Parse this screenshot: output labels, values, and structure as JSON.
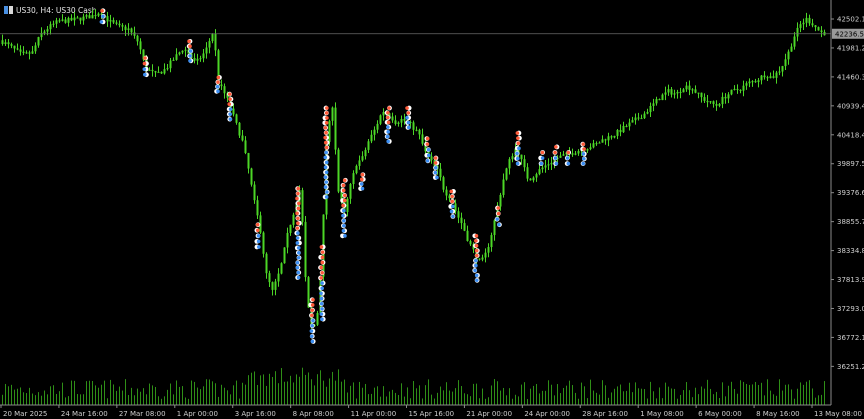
{
  "window": {
    "title": "US30, H4: US30 Cash"
  },
  "colors": {
    "background": "#000000",
    "candle": "#4cd626",
    "volume": "#2f8f17",
    "axis": "#8a8a8a",
    "label": "#cfcfcf",
    "price_line": "#6a6a6a",
    "price_box": "#9a9a9a",
    "marker_sell": "#ff5b3a",
    "marker_buy": "#3c8ef2"
  },
  "chart_data": {
    "type": "candlestick",
    "symbol": "US30",
    "timeframe": "H4",
    "current_price": "42236.51",
    "y_ticks": [
      "42502.13",
      "41981.22",
      "41460.31",
      "40939.40",
      "40418.49",
      "39897.58",
      "39376.67",
      "38855.76",
      "38334.85",
      "37813.94",
      "37293.03",
      "36772.12",
      "36251.21"
    ],
    "x_ticks": [
      "20 Mar 2025",
      "24 Mar 16:00",
      "27 Mar 08:00",
      "1 Apr 00:00",
      "3 Apr 16:00",
      "8 Apr 08:00",
      "11 Apr 00:00",
      "15 Apr 16:00",
      "21 Apr 00:00",
      "24 Apr 00:00",
      "28 Apr 16:00",
      "1 May 08:00",
      "6 May 00:00",
      "8 May 16:00",
      "13 May 08:00"
    ],
    "ylim": [
      36150,
      42700
    ],
    "close_path": [
      [
        0,
        42120
      ],
      [
        12,
        41980
      ],
      [
        22,
        41850
      ],
      [
        32,
        41900
      ],
      [
        40,
        42220
      ],
      [
        48,
        42350
      ],
      [
        58,
        42460
      ],
      [
        70,
        42480
      ],
      [
        82,
        42520
      ],
      [
        92,
        42560
      ],
      [
        100,
        42640
      ],
      [
        108,
        42470
      ],
      [
        118,
        42360
      ],
      [
        128,
        42320
      ],
      [
        138,
        42080
      ],
      [
        145,
        41620
      ],
      [
        155,
        41500
      ],
      [
        165,
        41600
      ],
      [
        175,
        41820
      ],
      [
        183,
        41980
      ],
      [
        188,
        41890
      ],
      [
        195,
        41700
      ],
      [
        205,
        41920
      ],
      [
        213,
        42300
      ],
      [
        218,
        41350
      ],
      [
        226,
        41100
      ],
      [
        234,
        40700
      ],
      [
        242,
        40300
      ],
      [
        248,
        39800
      ],
      [
        254,
        39200
      ],
      [
        260,
        38700
      ],
      [
        266,
        37900
      ],
      [
        272,
        37600
      ],
      [
        280,
        38000
      ],
      [
        288,
        38700
      ],
      [
        296,
        39200
      ],
      [
        300,
        39500
      ],
      [
        306,
        37500
      ],
      [
        312,
        36850
      ],
      [
        318,
        37300
      ],
      [
        322,
        38500
      ],
      [
        326,
        40300
      ],
      [
        332,
        40950
      ],
      [
        338,
        39400
      ],
      [
        344,
        39000
      ],
      [
        350,
        39500
      ],
      [
        356,
        39900
      ],
      [
        362,
        40000
      ],
      [
        368,
        40300
      ],
      [
        374,
        40500
      ],
      [
        382,
        40850
      ],
      [
        388,
        40800
      ],
      [
        395,
        40650
      ],
      [
        402,
        40700
      ],
      [
        410,
        40600
      ],
      [
        418,
        40450
      ],
      [
        425,
        40100
      ],
      [
        432,
        39900
      ],
      [
        438,
        39750
      ],
      [
        444,
        39400
      ],
      [
        450,
        39300
      ],
      [
        456,
        39000
      ],
      [
        462,
        38800
      ],
      [
        468,
        38500
      ],
      [
        474,
        38300
      ],
      [
        480,
        38100
      ],
      [
        486,
        38300
      ],
      [
        492,
        38700
      ],
      [
        498,
        39200
      ],
      [
        504,
        39700
      ],
      [
        510,
        40000
      ],
      [
        516,
        40200
      ],
      [
        522,
        39900
      ],
      [
        528,
        39600
      ],
      [
        534,
        39700
      ],
      [
        540,
        39800
      ],
      [
        548,
        39900
      ],
      [
        556,
        40000
      ],
      [
        564,
        40050
      ],
      [
        572,
        40100
      ],
      [
        580,
        40150
      ],
      [
        588,
        40200
      ],
      [
        596,
        40250
      ],
      [
        604,
        40350
      ],
      [
        612,
        40400
      ],
      [
        620,
        40500
      ],
      [
        628,
        40600
      ],
      [
        636,
        40700
      ],
      [
        644,
        40800
      ],
      [
        652,
        40950
      ],
      [
        660,
        41100
      ],
      [
        668,
        41200
      ],
      [
        676,
        41150
      ],
      [
        684,
        41300
      ],
      [
        692,
        41250
      ],
      [
        700,
        41100
      ],
      [
        708,
        41000
      ],
      [
        716,
        40950
      ],
      [
        724,
        41100
      ],
      [
        732,
        41200
      ],
      [
        740,
        41250
      ],
      [
        748,
        41350
      ],
      [
        756,
        41400
      ],
      [
        764,
        41500
      ],
      [
        772,
        41450
      ],
      [
        780,
        41600
      ],
      [
        788,
        41900
      ],
      [
        794,
        42200
      ],
      [
        800,
        42400
      ],
      [
        806,
        42500
      ],
      [
        812,
        42420
      ],
      [
        818,
        42300
      ],
      [
        822,
        42250
      ]
    ],
    "marker_clusters": [
      {
        "x": 102,
        "top": 42650,
        "bottom": 42450
      },
      {
        "x": 145,
        "top": 41800,
        "bottom": 41500
      },
      {
        "x": 190,
        "top": 42100,
        "bottom": 41750
      },
      {
        "x": 218,
        "top": 41450,
        "bottom": 41200
      },
      {
        "x": 230,
        "top": 41150,
        "bottom": 40700
      },
      {
        "x": 258,
        "top": 38800,
        "bottom": 38400
      },
      {
        "x": 298,
        "top": 39450,
        "bottom": 37850
      },
      {
        "x": 312,
        "top": 37450,
        "bottom": 36700
      },
      {
        "x": 322,
        "top": 38400,
        "bottom": 37100
      },
      {
        "x": 326,
        "top": 40900,
        "bottom": 39300
      },
      {
        "x": 344,
        "top": 39600,
        "bottom": 38600
      },
      {
        "x": 362,
        "top": 39700,
        "bottom": 39450
      },
      {
        "x": 388,
        "top": 40900,
        "bottom": 40300
      },
      {
        "x": 408,
        "top": 40900,
        "bottom": 40550
      },
      {
        "x": 428,
        "top": 40350,
        "bottom": 39950
      },
      {
        "x": 436,
        "top": 40000,
        "bottom": 39650
      },
      {
        "x": 452,
        "top": 39400,
        "bottom": 38950
      },
      {
        "x": 476,
        "top": 38600,
        "bottom": 37800
      },
      {
        "x": 498,
        "top": 39100,
        "bottom": 38800
      },
      {
        "x": 518,
        "top": 40450,
        "bottom": 39900
      },
      {
        "x": 542,
        "top": 40100,
        "bottom": 39900
      },
      {
        "x": 556,
        "top": 40200,
        "bottom": 39900
      },
      {
        "x": 568,
        "top": 40100,
        "bottom": 39900
      },
      {
        "x": 584,
        "top": 40250,
        "bottom": 39900
      }
    ]
  }
}
